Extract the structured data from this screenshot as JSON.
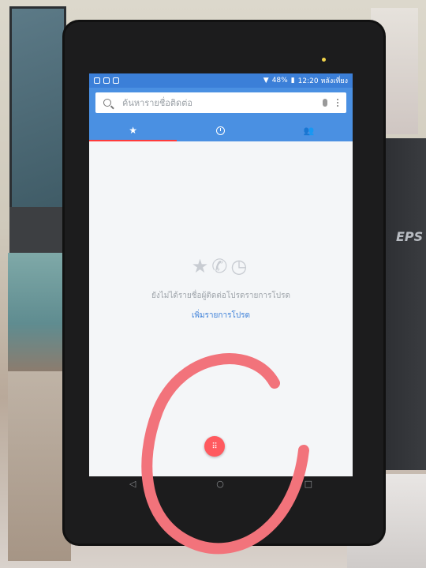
{
  "printer": {
    "brand": "EPS"
  },
  "status_bar": {
    "battery": "48%",
    "time": "12:20 หลังเที่ยง"
  },
  "search": {
    "placeholder": "ค้นหารายชื่อติดต่อ"
  },
  "tabs": [
    {
      "icon": "star-icon",
      "active": true
    },
    {
      "icon": "clock-icon",
      "active": false
    },
    {
      "icon": "people-icon",
      "active": false
    }
  ],
  "empty_state": {
    "message": "ยังไม่ได้รายชื่อผู้ติดต่อโปรดรายการโปรด",
    "link": "เพิ่มรายการโปรด"
  },
  "nav": {
    "back": "◁",
    "home": "○",
    "recents": "□"
  },
  "colors": {
    "appbar": "#4a90e2",
    "statusbar": "#3b7fd8",
    "fab": "#ff5a5f",
    "annotation": "#f2737b"
  }
}
